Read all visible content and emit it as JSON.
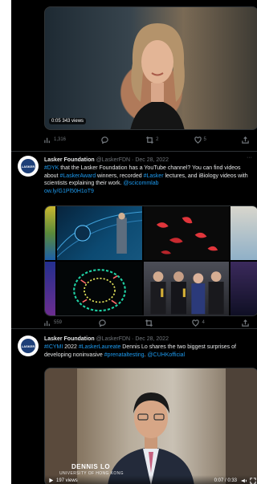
{
  "tweet1": {
    "video": {
      "duration": "0:05",
      "views": "343 views"
    },
    "actions": {
      "views": "1,316",
      "replies": "",
      "retweets": "2",
      "likes": "5"
    }
  },
  "tweet2": {
    "display_name": "Lasker Foundation",
    "handle": "@LaskerFDN",
    "date": "· Dec 28, 2022",
    "avatar_text": "LASKER",
    "body": {
      "hashtag1": "#DYK",
      "text1": " that the Lasker Foundation has a YouTube channel? You can find videos about ",
      "hashtag2": "#LaskerAward",
      "text2": " winners, recorded ",
      "hashtag3": "#Lasker",
      "text3": " lectures, and iBiology videos with scientists explaining their work. ",
      "mention": "@scicommlab",
      "link": "ow.ly/G1Pl50H1oT9"
    },
    "actions": {
      "views": "559",
      "replies": "",
      "retweets": "",
      "likes": "4"
    }
  },
  "tweet3": {
    "display_name": "Lasker Foundation",
    "handle": "@LaskerFDN",
    "date": "· Dec 28, 2022",
    "avatar_text": "LASKER",
    "body": {
      "hashtag1": "#ICYMI",
      "text1": " 2022 ",
      "hashtag2": "#LaskerLaureate",
      "text2": " Dennis Lo shares the two biggest surprises of developing noninvasive ",
      "hashtag3": "#prenataltesting",
      "text3": ". ",
      "mention": "@CUHKofficial"
    },
    "video": {
      "caption": "DENNIS LO",
      "subcaption": "UNIVERSITY OF HONG KONG",
      "views": "197 views",
      "timecode": "0:07 / 0:33"
    }
  },
  "colors": {
    "link": "#1d9bf0",
    "background": "#000000",
    "muted": "#71767b"
  }
}
